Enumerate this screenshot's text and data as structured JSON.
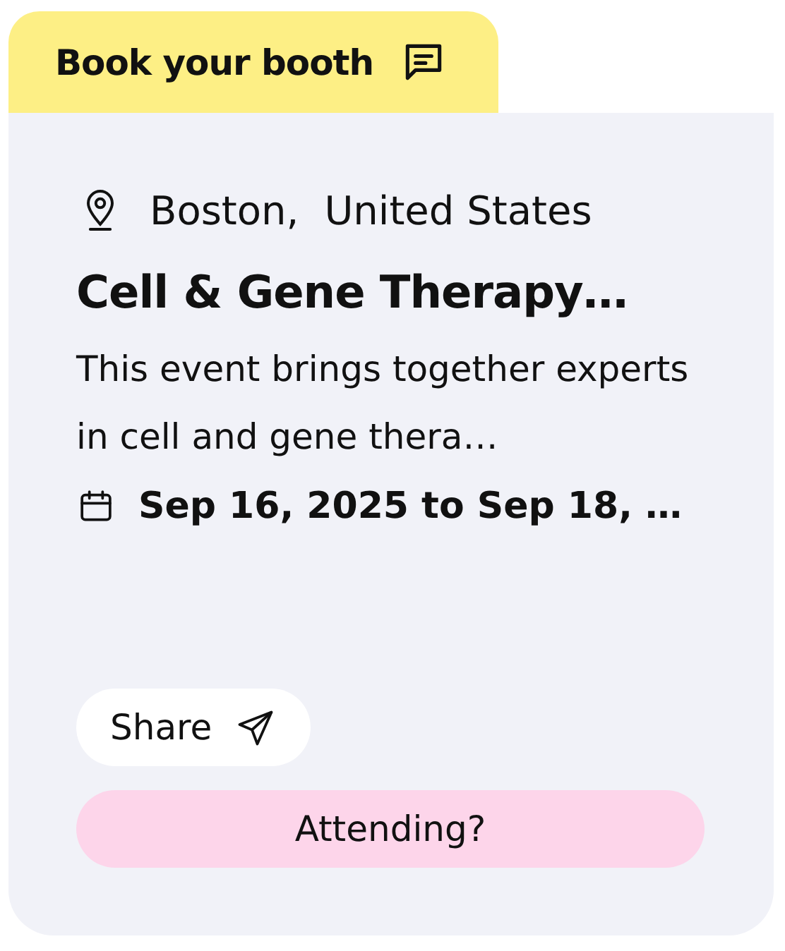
{
  "tab": {
    "label": "Book your booth"
  },
  "location": {
    "city": "Boston,",
    "country": "United States"
  },
  "title": "Cell & Gene Therapy…",
  "description": "This event brings together experts in cell and gene thera…",
  "dates": "Sep 16, 2025 to Sep 18, …",
  "buttons": [
    {
      "label": "Share",
      "kind": "share"
    },
    {
      "label": "Attending?",
      "kind": "attend"
    }
  ]
}
